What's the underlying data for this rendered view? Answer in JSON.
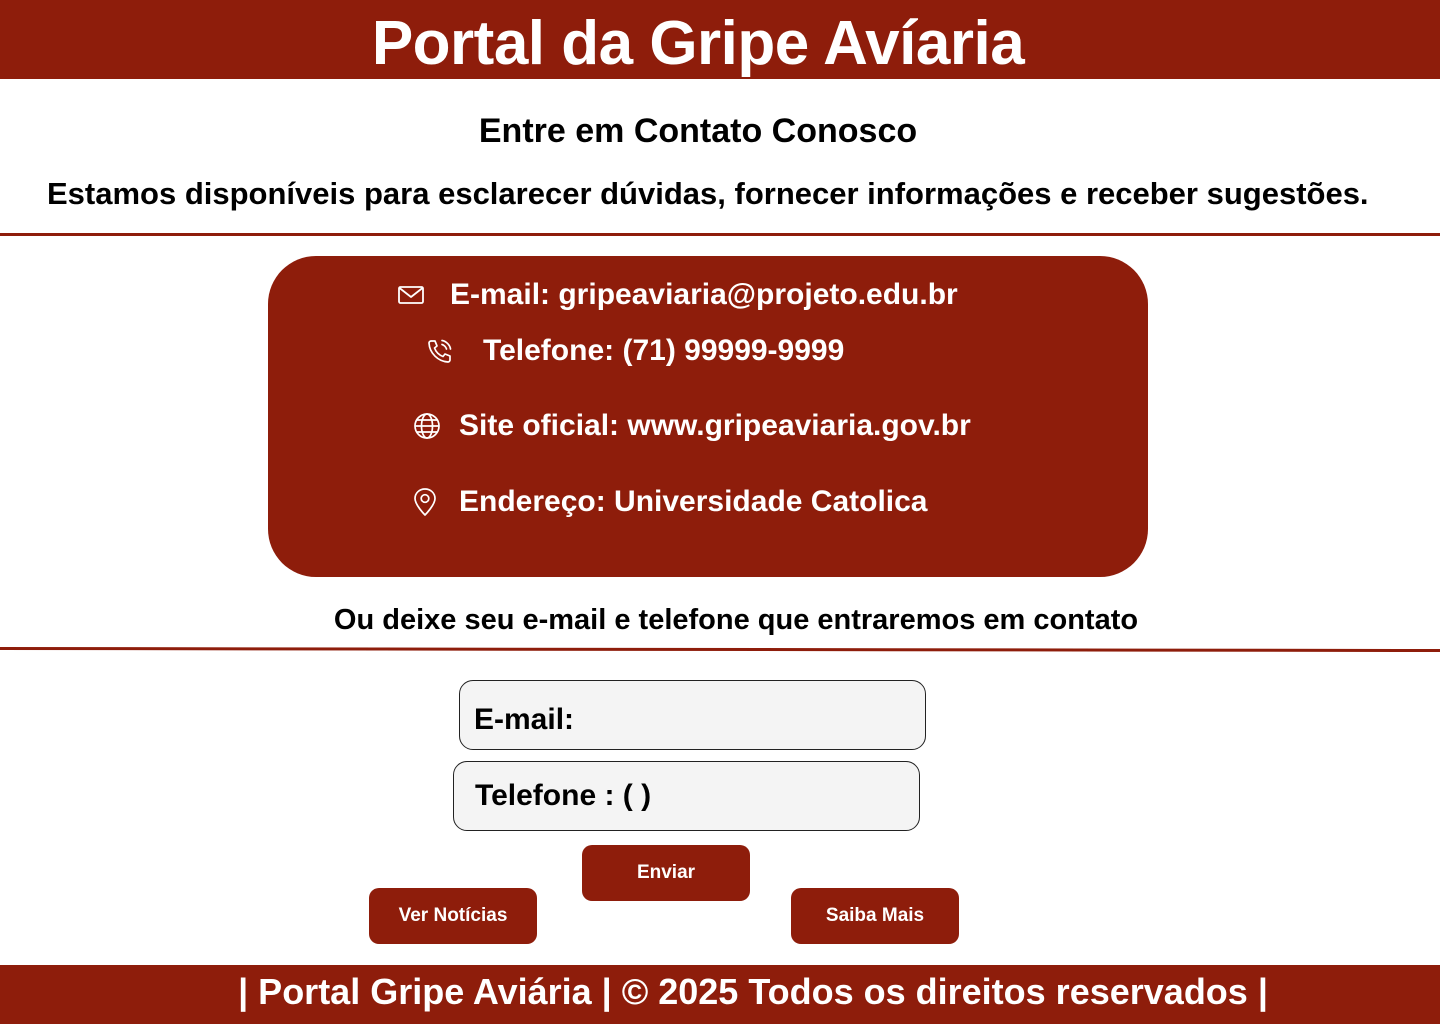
{
  "header": {
    "title": "Portal da Gripe Avíaria"
  },
  "contact_section": {
    "title": "Entre em Contato Conosco",
    "subtitle": "Estamos disponíveis para esclarecer dúvidas, fornecer informações e receber sugestões."
  },
  "contact_card": {
    "items": [
      {
        "icon": "mail-icon",
        "label": "E-mail: gripeaviaria@projeto.edu.br"
      },
      {
        "icon": "phone-icon",
        "label": "Telefone: (71) 99999-9999"
      },
      {
        "icon": "globe-icon",
        "label": "Site oficial: www.gripeaviaria.gov.br"
      },
      {
        "icon": "map-pin-icon",
        "label": "Endereço: Universidade Catolica"
      }
    ]
  },
  "form": {
    "intro": "Ou deixe seu e-mail e telefone que entraremos em contato",
    "email_label": "E-mail:",
    "phone_label": "Telefone : ( )",
    "send_button": "Enviar"
  },
  "buttons": {
    "news": "Ver Notícias",
    "more": "Saiba Mais"
  },
  "footer": {
    "text": "| Portal Gripe Aviária | © 2025 Todos os direitos reservados |"
  },
  "colors": {
    "brand": "#8e1d0b",
    "field_background": "#f4f4f4"
  }
}
